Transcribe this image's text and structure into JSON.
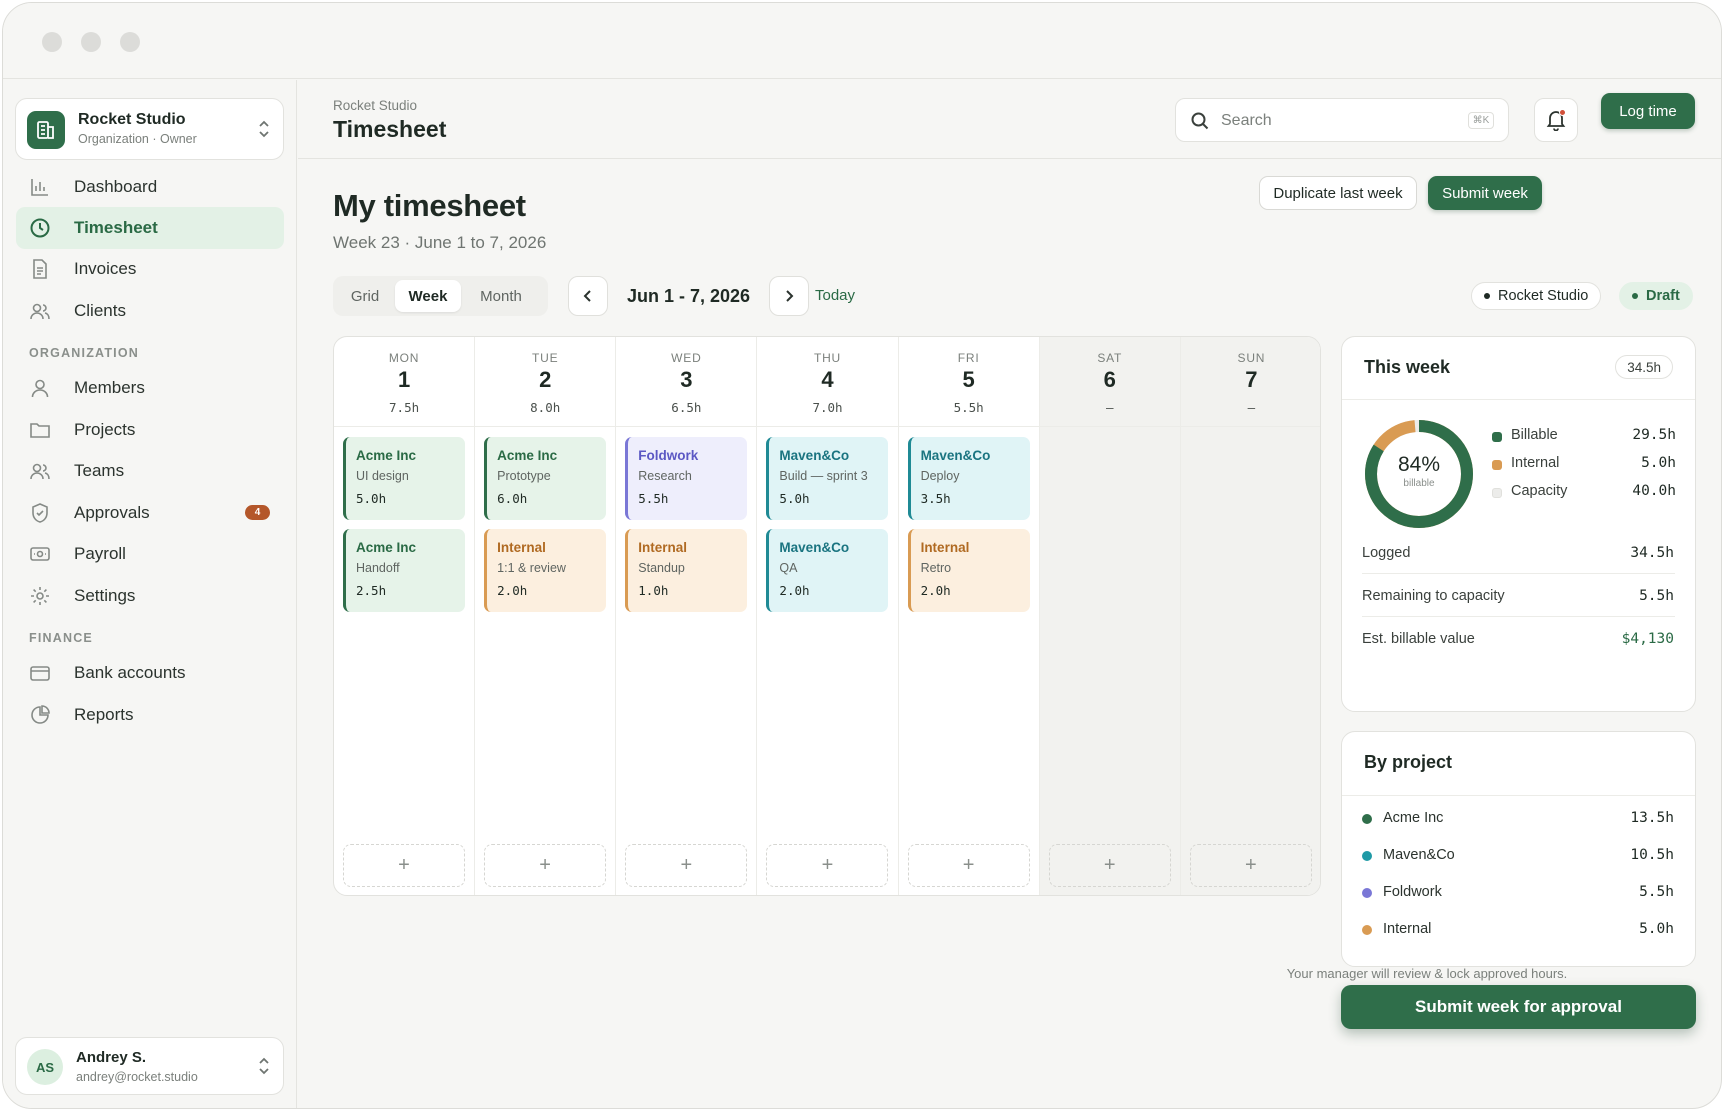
{
  "org": {
    "name": "Rocket Studio",
    "role": "Organization · Owner"
  },
  "nav": {
    "main": [
      "Dashboard",
      "Timesheet",
      "Invoices",
      "Clients"
    ],
    "organization_label": "ORGANIZATION",
    "organization": [
      "Members",
      "Projects",
      "Teams",
      "Approvals",
      "Payroll",
      "Settings"
    ],
    "approvals_badge": "4",
    "finance_label": "FINANCE",
    "finance": [
      "Bank accounts",
      "Reports"
    ]
  },
  "user": {
    "initials": "AS",
    "name": "Andrey S.",
    "email": "andrey@rocket.studio"
  },
  "header": {
    "breadcrumb": "Rocket Studio",
    "title": "Timesheet",
    "search_placeholder": "Search",
    "search_shortcut": "⌘K",
    "log_time": "Log time"
  },
  "page": {
    "title": "My timesheet",
    "subtitle": "Week 23 · June 1 to 7, 2026",
    "duplicate": "Duplicate last week",
    "submit": "Submit week"
  },
  "toolbar": {
    "tabs": [
      "Grid",
      "Week",
      "Month"
    ],
    "active_tab": "Week",
    "range": "Jun 1 - 7, 2026",
    "today": "Today",
    "org_pill": "Rocket Studio",
    "status_pill": "Draft"
  },
  "days": [
    {
      "dow": "MON",
      "num": "1",
      "hours": "7.5h",
      "entries": [
        {
          "project": "Acme Inc",
          "task": "UI design",
          "hours": "5.0h",
          "kind": "acme"
        },
        {
          "project": "Acme Inc",
          "task": "Handoff",
          "hours": "2.5h",
          "kind": "acme"
        }
      ]
    },
    {
      "dow": "TUE",
      "num": "2",
      "hours": "8.0h",
      "entries": [
        {
          "project": "Acme Inc",
          "task": "Prototype",
          "hours": "6.0h",
          "kind": "acme"
        },
        {
          "project": "Internal",
          "task": "1:1 & review",
          "hours": "2.0h",
          "kind": "internal"
        }
      ]
    },
    {
      "dow": "WED",
      "num": "3",
      "hours": "6.5h",
      "entries": [
        {
          "project": "Foldwork",
          "task": "Research",
          "hours": "5.5h",
          "kind": "fold"
        },
        {
          "project": "Internal",
          "task": "Standup",
          "hours": "1.0h",
          "kind": "internal"
        }
      ]
    },
    {
      "dow": "THU",
      "num": "4",
      "hours": "7.0h",
      "entries": [
        {
          "project": "Maven&Co",
          "task": "Build — sprint 3",
          "hours": "5.0h",
          "kind": "maven"
        },
        {
          "project": "Maven&Co",
          "task": "QA",
          "hours": "2.0h",
          "kind": "maven"
        }
      ]
    },
    {
      "dow": "FRI",
      "num": "5",
      "hours": "5.5h",
      "entries": [
        {
          "project": "Maven&Co",
          "task": "Deploy",
          "hours": "3.5h",
          "kind": "maven"
        },
        {
          "project": "Internal",
          "task": "Retro",
          "hours": "2.0h",
          "kind": "internal"
        }
      ]
    },
    {
      "dow": "SAT",
      "num": "6",
      "hours": "–",
      "entries": []
    },
    {
      "dow": "SUN",
      "num": "7",
      "hours": "–",
      "entries": []
    }
  ],
  "add_symbol": "+",
  "this_week": {
    "title": "This week",
    "total": "34.5h",
    "percent": "84%",
    "percent_label": "billable",
    "billable_fraction": 0.84,
    "legend": [
      {
        "label": "Billable",
        "value": "29.5h",
        "color": "#2f6e4a"
      },
      {
        "label": "Internal",
        "value": "5.0h",
        "color": "#d99b53"
      },
      {
        "label": "Capacity",
        "value": "40.0h",
        "color": "#ececea"
      }
    ],
    "stats": [
      {
        "label": "Logged",
        "value": "34.5h"
      },
      {
        "label": "Remaining to capacity",
        "value": "5.5h"
      },
      {
        "label": "Est. billable value",
        "value": "$4,130"
      }
    ]
  },
  "by_project": {
    "title": "By project",
    "rows": [
      {
        "name": "Acme Inc",
        "value": "13.5h",
        "color": "#2f6e4a"
      },
      {
        "name": "Maven&Co",
        "value": "10.5h",
        "color": "#1f9aa6"
      },
      {
        "name": "Foldwork",
        "value": "5.5h",
        "color": "#7a77d6"
      },
      {
        "name": "Internal",
        "value": "5.0h",
        "color": "#d99b53"
      }
    ]
  },
  "approval": {
    "button": "Submit week for approval",
    "note": "Your manager will review & lock approved hours."
  },
  "colors": {
    "accent": "#2f6e4a",
    "accent_soft": "#e3f1e6",
    "badge": "#b4572a"
  }
}
